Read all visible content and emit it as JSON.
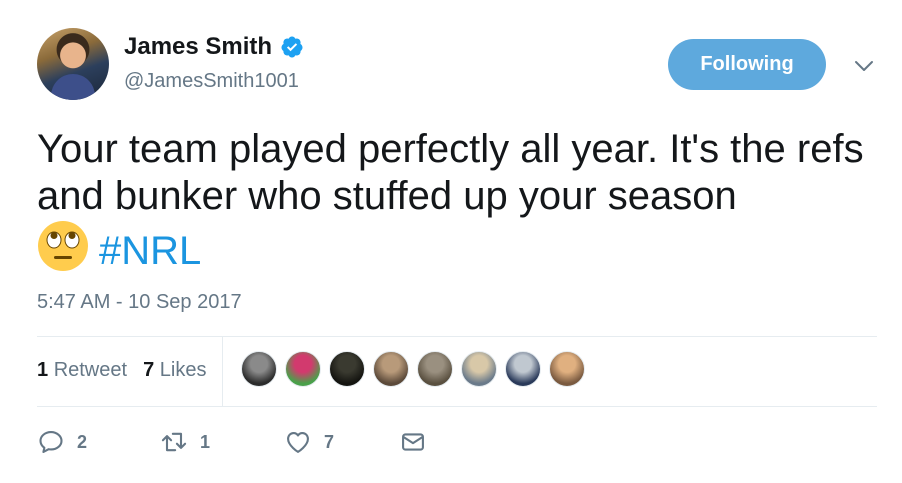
{
  "user": {
    "display_name": "James Smith",
    "handle": "@JamesSmith1001",
    "verified": true
  },
  "follow_button": {
    "label": "Following"
  },
  "tweet": {
    "text_line": "Your team played perfectly all year. It's the refs and bunker who stuffed up your season",
    "emoji": "face-with-rolling-eyes",
    "hashtag": "#NRL",
    "timestamp": "5:47 AM - 10 Sep 2017"
  },
  "stats": {
    "retweets_count": "1",
    "retweets_label": "Retweet",
    "likes_count": "7",
    "likes_label": "Likes"
  },
  "likers": [
    {
      "color_a": "#8a8a8a",
      "color_b": "#2b2b2b"
    },
    {
      "color_a": "#d23a6e",
      "color_b": "#4aa04a"
    },
    {
      "color_a": "#3a3a30",
      "color_b": "#141410"
    },
    {
      "color_a": "#b89a7a",
      "color_b": "#5c4a3a"
    },
    {
      "color_a": "#9a9080",
      "color_b": "#5a5040"
    },
    {
      "color_a": "#d8c8a8",
      "color_b": "#6a7a8a"
    },
    {
      "color_a": "#c0c8d0",
      "color_b": "#2a3a5a"
    },
    {
      "color_a": "#e0b080",
      "color_b": "#7a5a40"
    }
  ],
  "actions": {
    "reply_count": "2",
    "retweet_count": "1",
    "like_count": "7"
  },
  "colors": {
    "accent": "#1b95e0",
    "button": "#5ea9dd",
    "muted": "#657786",
    "divider": "#e6ecf0"
  }
}
